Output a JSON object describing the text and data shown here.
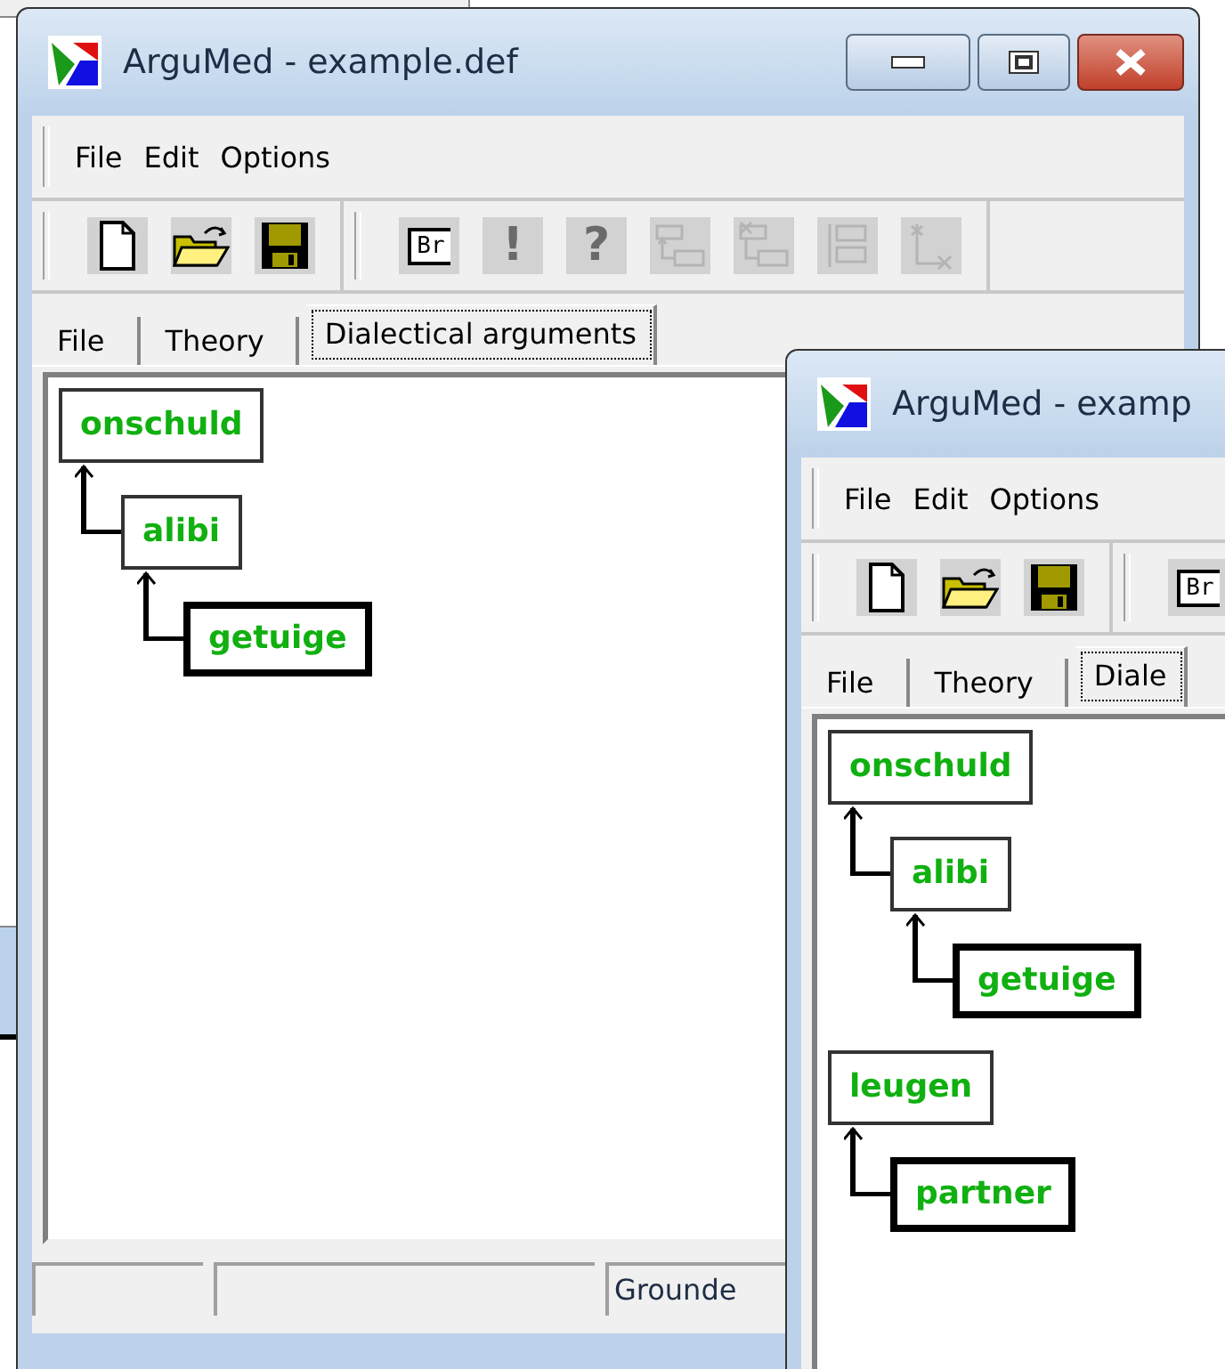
{
  "windows": [
    {
      "title": "ArguMed - example.def",
      "menu": [
        {
          "label": "File"
        },
        {
          "label": "Edit"
        },
        {
          "label": "Options"
        }
      ],
      "toolbar": [
        [
          {
            "kind": "new",
            "disabled": false
          },
          {
            "kind": "open",
            "disabled": false
          },
          {
            "kind": "save",
            "disabled": false
          }
        ],
        [
          {
            "kind": "text",
            "label": "Br",
            "disabled": false
          },
          {
            "kind": "glyph",
            "label": "!",
            "disabled": true
          },
          {
            "kind": "glyph",
            "label": "?",
            "disabled": true
          },
          {
            "kind": "tree-up",
            "disabled": true
          },
          {
            "kind": "tree-down",
            "disabled": true
          },
          {
            "kind": "list",
            "disabled": true
          },
          {
            "kind": "axes",
            "disabled": true
          }
        ]
      ],
      "tabs": [
        {
          "label": "File",
          "selected": false
        },
        {
          "label": "Theory",
          "selected": false
        },
        {
          "label": "Dialectical arguments",
          "selected": true
        }
      ],
      "arguments": [
        {
          "label": "onschuld",
          "thick_border": false,
          "children": [
            {
              "label": "alibi",
              "thick_border": false,
              "children": [
                {
                  "label": "getuige",
                  "thick_border": true
                }
              ]
            }
          ]
        }
      ],
      "status_text": "Grounde"
    },
    {
      "title": "ArguMed - examp",
      "menu": [
        {
          "label": "File"
        },
        {
          "label": "Edit"
        },
        {
          "label": "Options"
        }
      ],
      "toolbar": [
        [
          {
            "kind": "new",
            "disabled": false
          },
          {
            "kind": "open",
            "disabled": false
          },
          {
            "kind": "save",
            "disabled": false
          }
        ],
        [
          {
            "kind": "text",
            "label": "Br",
            "disabled": false
          }
        ]
      ],
      "tabs": [
        {
          "label": "File",
          "selected": false
        },
        {
          "label": "Theory",
          "selected": false
        },
        {
          "label": "Diale",
          "selected": true
        }
      ],
      "arguments": [
        {
          "label": "onschuld",
          "thick_border": false,
          "children": [
            {
              "label": "alibi",
              "thick_border": false,
              "children": [
                {
                  "label": "getuige",
                  "thick_border": true
                }
              ]
            }
          ]
        },
        {
          "label": "leugen",
          "thick_border": false,
          "children": [
            {
              "label": "partner",
              "thick_border": true
            }
          ]
        }
      ]
    }
  ]
}
